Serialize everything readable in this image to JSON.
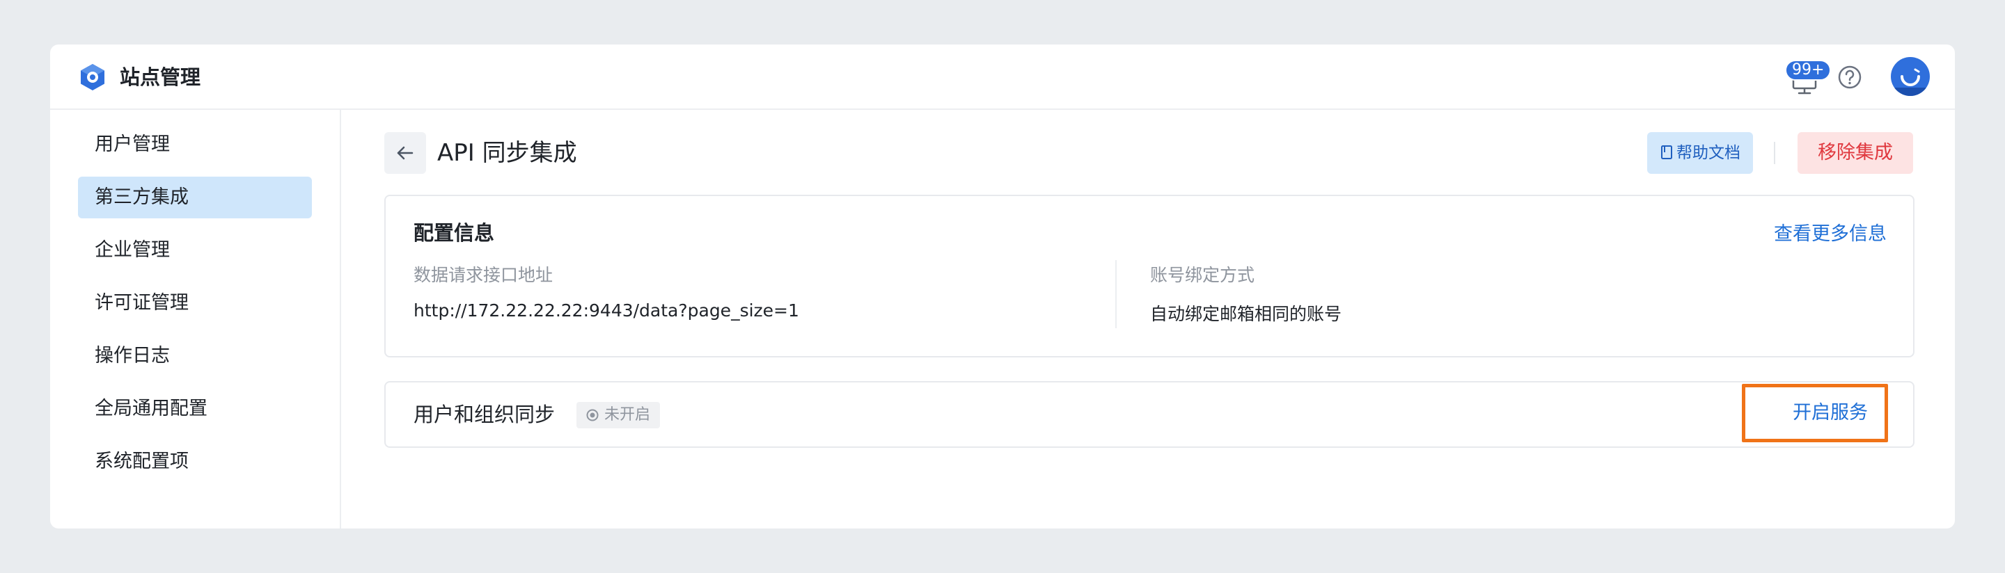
{
  "app": {
    "title": "站点管理",
    "logo_icon": "hexagon-logo-icon",
    "brand_color": "#2f6fdc"
  },
  "header": {
    "notification_badge": "99+",
    "monitor_icon": "monitor-icon",
    "help_icon": "question-circle-icon",
    "avatar_icon": "smile-avatar-icon"
  },
  "sidebar": {
    "items": [
      {
        "label": "用户管理",
        "active": false
      },
      {
        "label": "第三方集成",
        "active": true
      },
      {
        "label": "企业管理",
        "active": false
      },
      {
        "label": "许可证管理",
        "active": false
      },
      {
        "label": "操作日志",
        "active": false
      },
      {
        "label": "全局通用配置",
        "active": false
      },
      {
        "label": "系统配置项",
        "active": false
      }
    ]
  },
  "page": {
    "title": "API 同步集成",
    "back_icon": "arrow-left-icon",
    "doc_button": "帮助文档",
    "doc_icon": "book-icon",
    "remove_button": "移除集成"
  },
  "config_card": {
    "title": "配置信息",
    "more_link": "查看更多信息",
    "fields": [
      {
        "label": "数据请求接口地址",
        "value": "http://172.22.22.22:9443/data?page_size=1"
      },
      {
        "label": "账号绑定方式",
        "value": "自动绑定邮箱相同的账号"
      }
    ]
  },
  "sync_card": {
    "title": "用户和组织同步",
    "status": "未开启",
    "status_icon": "radio-dot-icon",
    "action": "开启服务",
    "highlight_color": "#f07318"
  }
}
